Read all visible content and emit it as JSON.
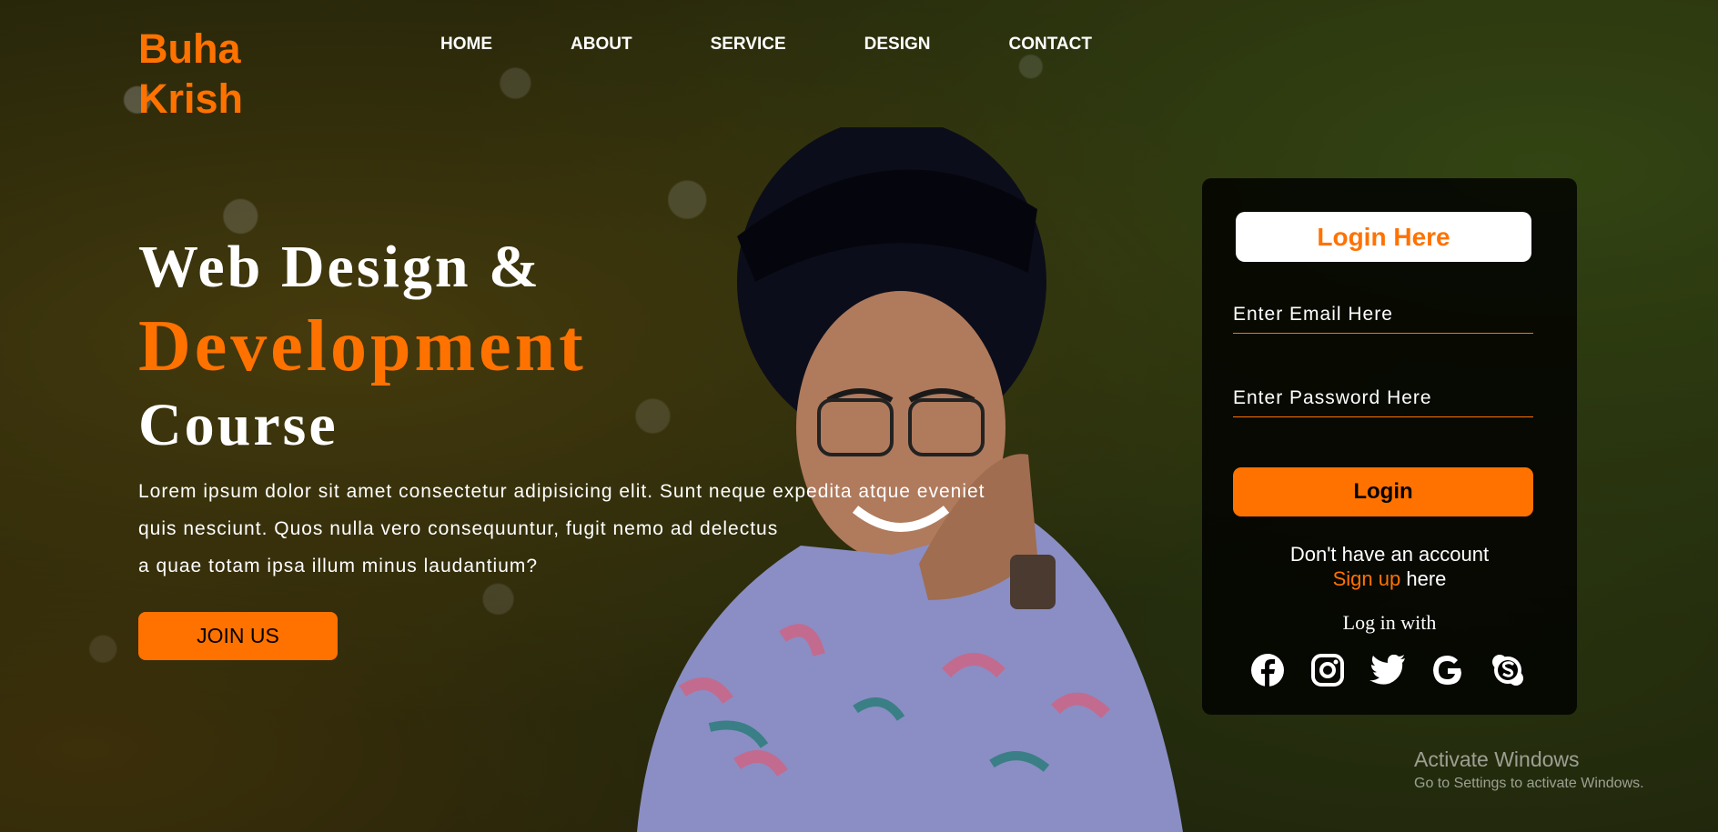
{
  "brand": {
    "line1": "Buha",
    "line2": "Krish",
    "color": "#ff7200"
  },
  "nav": {
    "items": [
      "HOME",
      "ABOUT",
      "SERVICE",
      "DESIGN",
      "CONTACT"
    ]
  },
  "hero": {
    "title_line1": "Web Design &",
    "title_line2": "Development",
    "title_line3": "Course",
    "paragraph_lines": [
      "Lorem ipsum dolor sit amet consectetur adipisicing elit. Sunt neque expedita atque eveniet",
      "quis nesciunt. Quos nulla vero consequuntur, fugit nemo ad delectus",
      "a quae totam ipsa illum minus laudantium?"
    ],
    "join_label": "JOIN US"
  },
  "login_form": {
    "title": "Login Here",
    "email_placeholder": "Enter Email Here",
    "password_placeholder": "Enter Password Here",
    "login_label": "Login",
    "no_account_text": "Don't have an account",
    "signup_link": "Sign up",
    "signup_suffix": " here",
    "login_with": "Log in with",
    "social_icons": [
      "facebook-icon",
      "instagram-icon",
      "twitter-icon",
      "google-icon",
      "skype-icon"
    ]
  },
  "watermark": {
    "title": "Activate Windows",
    "subtitle": "Go to Settings to activate Windows."
  },
  "colors": {
    "accent": "#ff7200",
    "form_bg": "#000000"
  }
}
